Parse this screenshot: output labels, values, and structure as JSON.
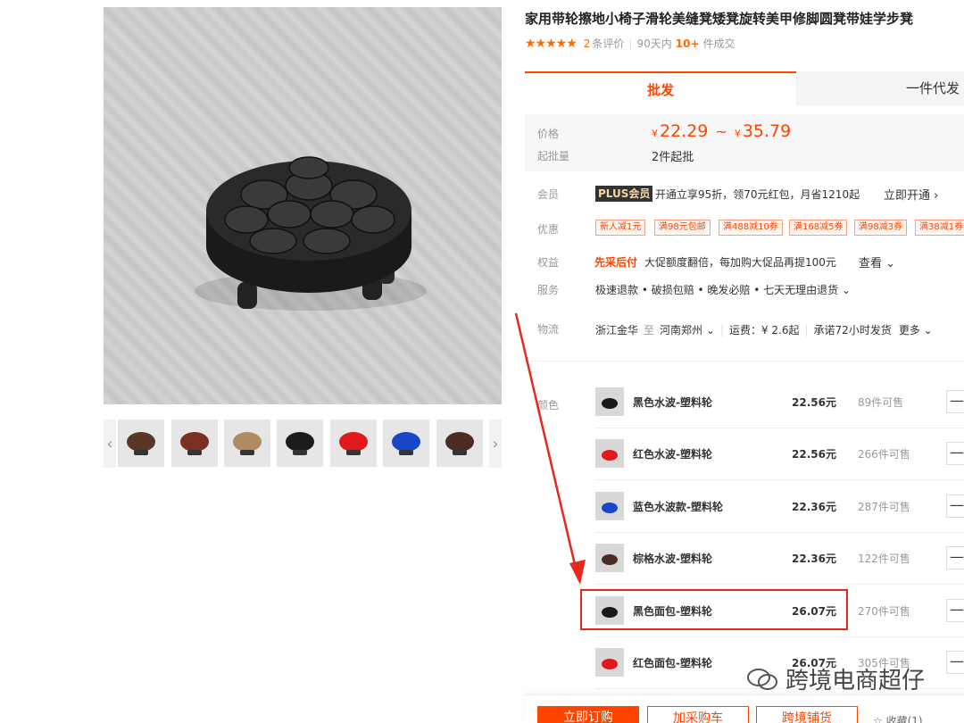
{
  "gallery": {
    "prev_arrow": "‹",
    "next_arrow": "›",
    "thumbnails": [
      {
        "color": "#5a3626"
      },
      {
        "color": "#7a2f22"
      },
      {
        "color": "#b08a62"
      },
      {
        "color": "#1c1c1c"
      },
      {
        "color": "#e01a1a"
      },
      {
        "color": "#1747c8"
      },
      {
        "color": "#4a2c22"
      }
    ]
  },
  "product": {
    "title": "家用带轮擦地小椅子滑轮美缝凳矮凳旋转美甲修脚圆凳带娃学步凳",
    "stars": "★★★★★",
    "review_count": "2",
    "review_label": "条评价",
    "sales_prefix": "90天内",
    "sales_count": "10+",
    "sales_suffix": "件成交"
  },
  "tabs": {
    "wholesale": "批发",
    "dropship": "一件代发"
  },
  "price": {
    "label": "价格",
    "currency": "¥",
    "low": "22.29",
    "tilde": "~",
    "high": "35.79",
    "moq_label": "起批量",
    "moq_value": "2件起批"
  },
  "member": {
    "label": "会员",
    "badge": "PLUS会员",
    "text": "开通立享95折，领70元红包，月省1210起",
    "link": "立即开通 ›"
  },
  "discount": {
    "label": "优惠",
    "coupons": [
      "新人减1元",
      "满98元包邮",
      "满488减10券",
      "满168减5券",
      "满98减3券",
      "满38减1券"
    ]
  },
  "rights": {
    "label": "权益",
    "highlight": "先采后付",
    "text": "大促额度翻倍，每加购大促品再提100元",
    "link": "查看 ⌄"
  },
  "service": {
    "label": "服务",
    "text": "极速退款 • 破损包赔 • 晚发必赔 • 七天无理由退货 ⌄"
  },
  "logistics": {
    "label": "物流",
    "from": "浙江金华",
    "to_word": "至",
    "to": "河南郑州 ⌄",
    "fee": "运费：¥ 2.6起",
    "promise": "承诺72小时发货",
    "more": "更多 ⌄"
  },
  "sku": {
    "label": "颜色",
    "minus": "—",
    "items": [
      {
        "name": "黑色水波-塑料轮",
        "price": "22.56元",
        "stock": "89件可售",
        "color": "#1a1a1a"
      },
      {
        "name": "红色水波-塑料轮",
        "price": "22.56元",
        "stock": "266件可售",
        "color": "#e01a1a"
      },
      {
        "name": "蓝色水波款-塑料轮",
        "price": "22.36元",
        "stock": "287件可售",
        "color": "#1747c8"
      },
      {
        "name": "棕格水波-塑料轮",
        "price": "22.36元",
        "stock": "122件可售",
        "color": "#4a2c22"
      },
      {
        "name": "黑色面包-塑料轮",
        "price": "26.07元",
        "stock": "270件可售",
        "color": "#1a1a1a"
      },
      {
        "name": "红色面包-塑料轮",
        "price": "26.07元",
        "stock": "305件可售",
        "color": "#e01a1a"
      }
    ]
  },
  "watermark": {
    "text": "跨境电商超仔"
  },
  "actions": {
    "order": "立即订购",
    "cart": "加采购车",
    "cross": "跨境铺货",
    "favorite": "☆ 收藏(1)"
  },
  "colors": {
    "accent": "#ff4400",
    "annotation": "#e8261e"
  }
}
